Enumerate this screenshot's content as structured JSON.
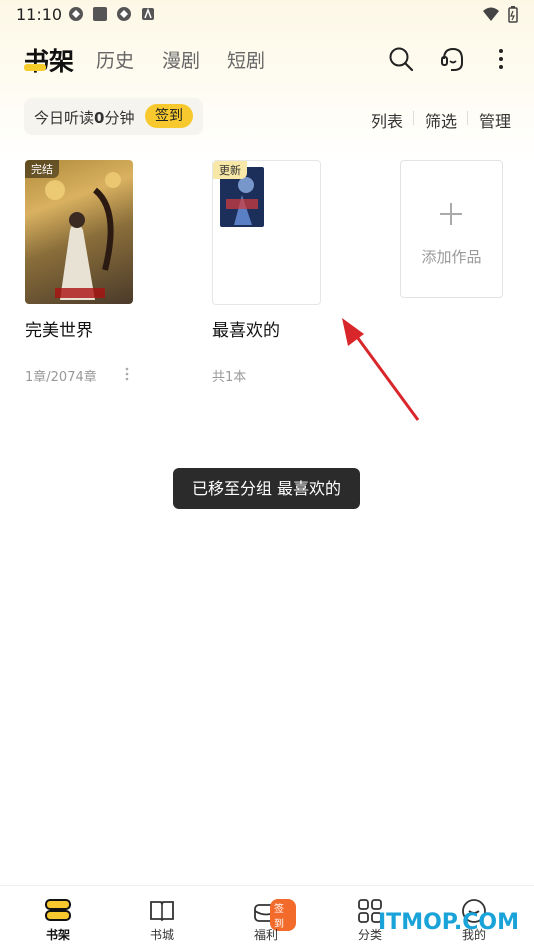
{
  "status": {
    "time": "11:10"
  },
  "tabs": [
    {
      "label": "书架",
      "active": true
    },
    {
      "label": "历史",
      "active": false
    },
    {
      "label": "漫剧",
      "active": false
    },
    {
      "label": "短剧",
      "active": false
    }
  ],
  "header_icons": [
    "search-icon",
    "customer-service-icon",
    "more-icon"
  ],
  "checkin": {
    "prefix": "今日听读",
    "minutes": "0",
    "suffix": "分钟",
    "button": "签到"
  },
  "view_options": [
    "列表",
    "筛选",
    "管理"
  ],
  "books": [
    {
      "title": "完美世界",
      "meta": "1章/2074章",
      "badge": "完结"
    },
    {
      "title": "最喜欢的",
      "meta": "共1本",
      "badge": "更新"
    }
  ],
  "add_card": {
    "label": "添加作品"
  },
  "toast": "已移至分组 最喜欢的",
  "bottom_nav": [
    {
      "label": "书架",
      "icon": "bookshelf-icon",
      "active": true
    },
    {
      "label": "书城",
      "icon": "book-open-icon",
      "active": false
    },
    {
      "label": "福利",
      "icon": "gift-icon",
      "active": false,
      "badge": "签到"
    },
    {
      "label": "分类",
      "icon": "grid-icon",
      "active": false
    },
    {
      "label": "我的",
      "icon": "profile-icon",
      "active": false
    }
  ],
  "watermark": "ITMOP.COM",
  "colors": {
    "accent": "#f7c92e",
    "arrow": "#d9262b",
    "toast_bg": "#2b2b2b"
  }
}
